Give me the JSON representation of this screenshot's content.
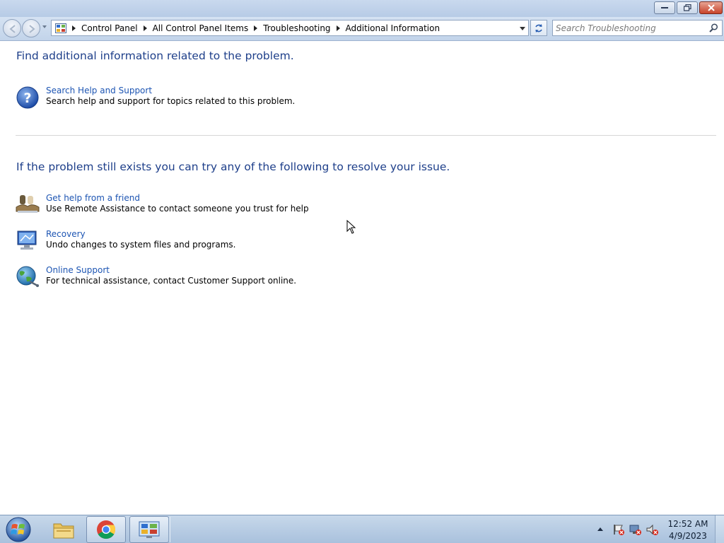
{
  "address": {
    "crumbs": [
      "Control Panel",
      "All Control Panel Items",
      "Troubleshooting",
      "Additional Information"
    ]
  },
  "search": {
    "placeholder": "Search Troubleshooting"
  },
  "main": {
    "heading1": "Find additional information related to the problem.",
    "help_item": {
      "link": "Search Help and Support",
      "desc": "Search help and support for topics related to this problem.",
      "icon": "help-question-icon"
    },
    "heading2": "If the problem still exists you can try any of the following to resolve your issue.",
    "items": [
      {
        "link": "Get help from a friend",
        "desc": "Use Remote Assistance to contact someone you trust for help",
        "icon": "remote-assistance-icon"
      },
      {
        "link": "Recovery",
        "desc": "Undo changes to system files and programs.",
        "icon": "recovery-icon"
      },
      {
        "link": "Online Support",
        "desc": "For technical assistance, contact Customer Support online.",
        "icon": "online-support-globe-icon"
      }
    ]
  },
  "taskbar": {
    "apps": [
      "file-explorer-icon",
      "chrome-icon",
      "control-panel-icon"
    ],
    "tray": [
      "action-center-icon",
      "network-icon",
      "volume-muted-icon"
    ],
    "time": "12:52 AM",
    "date": "4/9/2023"
  },
  "colors": {
    "link": "#1d55b3",
    "heading": "#1e3f8a"
  }
}
